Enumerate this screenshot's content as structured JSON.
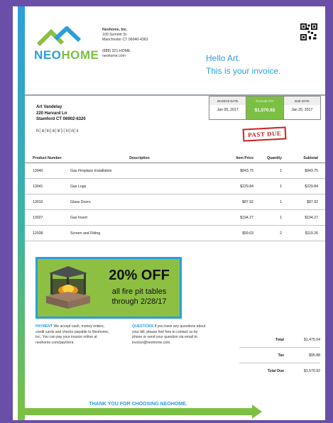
{
  "company": {
    "logo_part1": "NEO",
    "logo_part2": "HOME",
    "name": "Neohome, Inc.",
    "address1": "100 Summit St",
    "address2": "Manchester CT 06040-4363",
    "phone": "(888) 321-HOME",
    "web": "neohome.com"
  },
  "greeting": {
    "line1": "Hello Art.",
    "line2": "This is your invoice."
  },
  "customer": {
    "name": "Art Vandelay",
    "street": "220 Harvard Ln",
    "city": "Stamford CT  06902-6320",
    "barcode": "ǀǀı│ıǀı│ǀıǀ│ıǀı│ǀıǀ│ı│ǀıǀ│ıǀı│ǀı"
  },
  "invoice_info": {
    "date_label": "INVOICE DATE",
    "date": "Jan 05, 2017",
    "pay_label": "PLEASE PAY",
    "amount": "$1,570.92",
    "due_label": "DUE DATE",
    "due": "Jan 20, 2017"
  },
  "stamp": "PAST DUE",
  "table": {
    "headers": [
      "Product Number",
      "Description",
      "Item Price",
      "Quantity",
      "Subtotal"
    ],
    "rows": [
      [
        "13040",
        "Gas Fireplace Installation",
        "$843.75",
        "1",
        "$843.75"
      ],
      [
        "13041",
        "Gas Logs",
        "$229.84",
        "1",
        "$229.84"
      ],
      [
        "13010",
        "Glass Doors",
        "$87.92",
        "1",
        "$87.92"
      ],
      [
        "13027",
        "Gas Insert",
        "$194.27",
        "1",
        "$194.27"
      ],
      [
        "12038",
        "Screen and Fitting",
        "$59.63",
        "2",
        "$119.26"
      ]
    ]
  },
  "promo": {
    "headline": "20% OFF",
    "line1": "all fire pit tables",
    "line2": "through 2/28/17"
  },
  "footer": {
    "payment_label": "PAYMENT",
    "payment_text": "We accept cash, money orders, credit cards and checks payable to Neohome, Inc. You can pay your invoice online at neohome.com/payment.",
    "questions_label": "QUESTIONS",
    "questions_text": "If you have any questions about your bill, please feel free to contact us by phone or send your question via email to invoice@neohome.com."
  },
  "totals": [
    {
      "label": "Total",
      "value": "$1,475.04"
    },
    {
      "label": "Tax",
      "value": "$95.88"
    },
    {
      "label": "Total Due",
      "value": "$1,570.92"
    }
  ],
  "thanks": "THANK YOU FOR CHOOSING NEOHOME.",
  "colors": {
    "background": "#6a4fa8",
    "blue": "#2b9fdc",
    "green": "#7cc043",
    "stamp_red": "#cc2222"
  }
}
